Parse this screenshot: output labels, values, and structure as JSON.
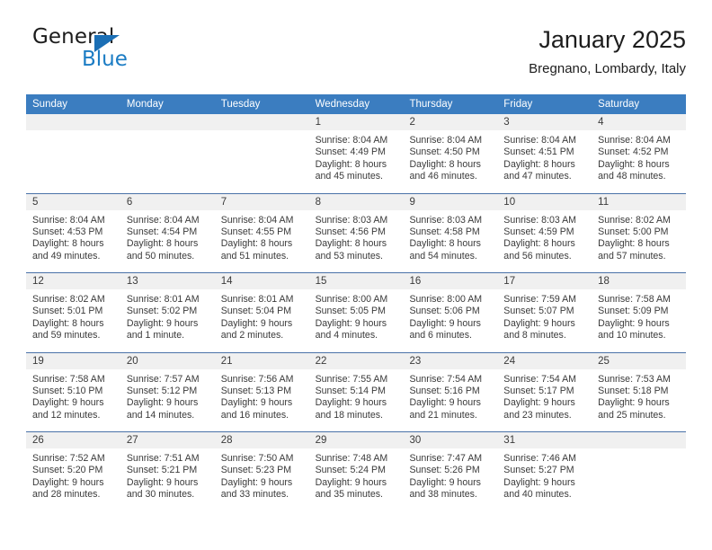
{
  "brand": {
    "name_part1": "General",
    "name_part2": "Blue",
    "triangle_icon": "blue-triangle-icon",
    "color_dark": "#1c1c1c",
    "color_blue": "#1b7cc4"
  },
  "header": {
    "title": "January 2025",
    "subtitle": "Bregnano, Lombardy, Italy"
  },
  "theme": {
    "header_blue": "#3b7dc0",
    "week_divider": "#4a72a8",
    "daynum_band": "#f0f0f0"
  },
  "weekdays": [
    "Sunday",
    "Monday",
    "Tuesday",
    "Wednesday",
    "Thursday",
    "Friday",
    "Saturday"
  ],
  "weeks": [
    [
      {
        "day": "",
        "empty": true,
        "sunrise": "",
        "sunset": "",
        "daylight1": "",
        "daylight2": ""
      },
      {
        "day": "",
        "empty": true,
        "sunrise": "",
        "sunset": "",
        "daylight1": "",
        "daylight2": ""
      },
      {
        "day": "",
        "empty": true,
        "sunrise": "",
        "sunset": "",
        "daylight1": "",
        "daylight2": ""
      },
      {
        "day": "1",
        "sunrise": "Sunrise: 8:04 AM",
        "sunset": "Sunset: 4:49 PM",
        "daylight1": "Daylight: 8 hours",
        "daylight2": "and 45 minutes."
      },
      {
        "day": "2",
        "sunrise": "Sunrise: 8:04 AM",
        "sunset": "Sunset: 4:50 PM",
        "daylight1": "Daylight: 8 hours",
        "daylight2": "and 46 minutes."
      },
      {
        "day": "3",
        "sunrise": "Sunrise: 8:04 AM",
        "sunset": "Sunset: 4:51 PM",
        "daylight1": "Daylight: 8 hours",
        "daylight2": "and 47 minutes."
      },
      {
        "day": "4",
        "sunrise": "Sunrise: 8:04 AM",
        "sunset": "Sunset: 4:52 PM",
        "daylight1": "Daylight: 8 hours",
        "daylight2": "and 48 minutes."
      }
    ],
    [
      {
        "day": "5",
        "sunrise": "Sunrise: 8:04 AM",
        "sunset": "Sunset: 4:53 PM",
        "daylight1": "Daylight: 8 hours",
        "daylight2": "and 49 minutes."
      },
      {
        "day": "6",
        "sunrise": "Sunrise: 8:04 AM",
        "sunset": "Sunset: 4:54 PM",
        "daylight1": "Daylight: 8 hours",
        "daylight2": "and 50 minutes."
      },
      {
        "day": "7",
        "sunrise": "Sunrise: 8:04 AM",
        "sunset": "Sunset: 4:55 PM",
        "daylight1": "Daylight: 8 hours",
        "daylight2": "and 51 minutes."
      },
      {
        "day": "8",
        "sunrise": "Sunrise: 8:03 AM",
        "sunset": "Sunset: 4:56 PM",
        "daylight1": "Daylight: 8 hours",
        "daylight2": "and 53 minutes."
      },
      {
        "day": "9",
        "sunrise": "Sunrise: 8:03 AM",
        "sunset": "Sunset: 4:58 PM",
        "daylight1": "Daylight: 8 hours",
        "daylight2": "and 54 minutes."
      },
      {
        "day": "10",
        "sunrise": "Sunrise: 8:03 AM",
        "sunset": "Sunset: 4:59 PM",
        "daylight1": "Daylight: 8 hours",
        "daylight2": "and 56 minutes."
      },
      {
        "day": "11",
        "sunrise": "Sunrise: 8:02 AM",
        "sunset": "Sunset: 5:00 PM",
        "daylight1": "Daylight: 8 hours",
        "daylight2": "and 57 minutes."
      }
    ],
    [
      {
        "day": "12",
        "sunrise": "Sunrise: 8:02 AM",
        "sunset": "Sunset: 5:01 PM",
        "daylight1": "Daylight: 8 hours",
        "daylight2": "and 59 minutes."
      },
      {
        "day": "13",
        "sunrise": "Sunrise: 8:01 AM",
        "sunset": "Sunset: 5:02 PM",
        "daylight1": "Daylight: 9 hours",
        "daylight2": "and 1 minute."
      },
      {
        "day": "14",
        "sunrise": "Sunrise: 8:01 AM",
        "sunset": "Sunset: 5:04 PM",
        "daylight1": "Daylight: 9 hours",
        "daylight2": "and 2 minutes."
      },
      {
        "day": "15",
        "sunrise": "Sunrise: 8:00 AM",
        "sunset": "Sunset: 5:05 PM",
        "daylight1": "Daylight: 9 hours",
        "daylight2": "and 4 minutes."
      },
      {
        "day": "16",
        "sunrise": "Sunrise: 8:00 AM",
        "sunset": "Sunset: 5:06 PM",
        "daylight1": "Daylight: 9 hours",
        "daylight2": "and 6 minutes."
      },
      {
        "day": "17",
        "sunrise": "Sunrise: 7:59 AM",
        "sunset": "Sunset: 5:07 PM",
        "daylight1": "Daylight: 9 hours",
        "daylight2": "and 8 minutes."
      },
      {
        "day": "18",
        "sunrise": "Sunrise: 7:58 AM",
        "sunset": "Sunset: 5:09 PM",
        "daylight1": "Daylight: 9 hours",
        "daylight2": "and 10 minutes."
      }
    ],
    [
      {
        "day": "19",
        "sunrise": "Sunrise: 7:58 AM",
        "sunset": "Sunset: 5:10 PM",
        "daylight1": "Daylight: 9 hours",
        "daylight2": "and 12 minutes."
      },
      {
        "day": "20",
        "sunrise": "Sunrise: 7:57 AM",
        "sunset": "Sunset: 5:12 PM",
        "daylight1": "Daylight: 9 hours",
        "daylight2": "and 14 minutes."
      },
      {
        "day": "21",
        "sunrise": "Sunrise: 7:56 AM",
        "sunset": "Sunset: 5:13 PM",
        "daylight1": "Daylight: 9 hours",
        "daylight2": "and 16 minutes."
      },
      {
        "day": "22",
        "sunrise": "Sunrise: 7:55 AM",
        "sunset": "Sunset: 5:14 PM",
        "daylight1": "Daylight: 9 hours",
        "daylight2": "and 18 minutes."
      },
      {
        "day": "23",
        "sunrise": "Sunrise: 7:54 AM",
        "sunset": "Sunset: 5:16 PM",
        "daylight1": "Daylight: 9 hours",
        "daylight2": "and 21 minutes."
      },
      {
        "day": "24",
        "sunrise": "Sunrise: 7:54 AM",
        "sunset": "Sunset: 5:17 PM",
        "daylight1": "Daylight: 9 hours",
        "daylight2": "and 23 minutes."
      },
      {
        "day": "25",
        "sunrise": "Sunrise: 7:53 AM",
        "sunset": "Sunset: 5:18 PM",
        "daylight1": "Daylight: 9 hours",
        "daylight2": "and 25 minutes."
      }
    ],
    [
      {
        "day": "26",
        "sunrise": "Sunrise: 7:52 AM",
        "sunset": "Sunset: 5:20 PM",
        "daylight1": "Daylight: 9 hours",
        "daylight2": "and 28 minutes."
      },
      {
        "day": "27",
        "sunrise": "Sunrise: 7:51 AM",
        "sunset": "Sunset: 5:21 PM",
        "daylight1": "Daylight: 9 hours",
        "daylight2": "and 30 minutes."
      },
      {
        "day": "28",
        "sunrise": "Sunrise: 7:50 AM",
        "sunset": "Sunset: 5:23 PM",
        "daylight1": "Daylight: 9 hours",
        "daylight2": "and 33 minutes."
      },
      {
        "day": "29",
        "sunrise": "Sunrise: 7:48 AM",
        "sunset": "Sunset: 5:24 PM",
        "daylight1": "Daylight: 9 hours",
        "daylight2": "and 35 minutes."
      },
      {
        "day": "30",
        "sunrise": "Sunrise: 7:47 AM",
        "sunset": "Sunset: 5:26 PM",
        "daylight1": "Daylight: 9 hours",
        "daylight2": "and 38 minutes."
      },
      {
        "day": "31",
        "sunrise": "Sunrise: 7:46 AM",
        "sunset": "Sunset: 5:27 PM",
        "daylight1": "Daylight: 9 hours",
        "daylight2": "and 40 minutes."
      },
      {
        "day": "",
        "empty": true,
        "sunrise": "",
        "sunset": "",
        "daylight1": "",
        "daylight2": ""
      }
    ]
  ]
}
